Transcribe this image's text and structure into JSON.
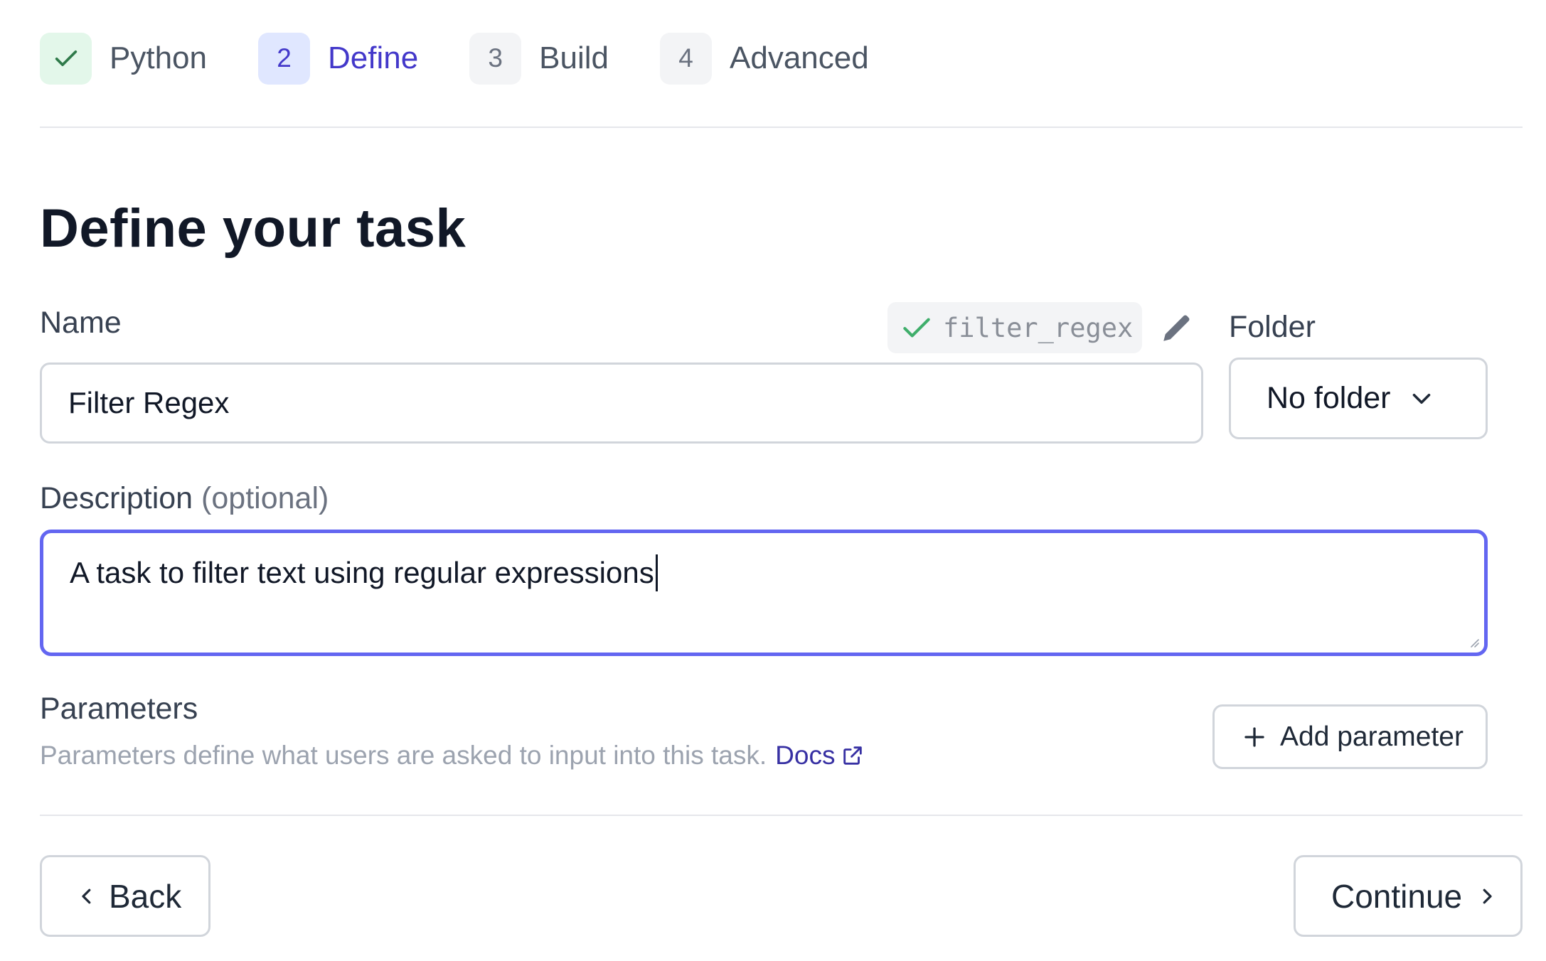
{
  "stepper": {
    "steps": [
      {
        "number": "",
        "label": "Python",
        "state": "done",
        "icon": "check-icon"
      },
      {
        "number": "2",
        "label": "Define",
        "state": "active"
      },
      {
        "number": "3",
        "label": "Build",
        "state": "pending"
      },
      {
        "number": "4",
        "label": "Advanced",
        "state": "pending"
      }
    ]
  },
  "page": {
    "title": "Define your task"
  },
  "name_field": {
    "label": "Name",
    "value": "Filter Regex",
    "slug": "filter_regex",
    "slug_status_icon": "check-icon",
    "edit_icon": "pencil-icon"
  },
  "folder_field": {
    "label": "Folder",
    "selected": "No folder",
    "icon": "chevron-down-icon"
  },
  "description_field": {
    "label": "Description",
    "optional_label": "(optional)",
    "value": "A task to filter text using regular expressions"
  },
  "parameters": {
    "title": "Parameters",
    "help_text": "Parameters define what users are asked to input into this task.",
    "docs_label": "Docs",
    "docs_icon": "external-link-icon",
    "add_button_label": "Add parameter",
    "add_icon": "plus-icon"
  },
  "footer": {
    "back_label": "Back",
    "continue_label": "Continue"
  },
  "colors": {
    "accent": "#4338ca",
    "focus_border": "#6366f1",
    "success": "#3fae6b",
    "border": "#d1d5db",
    "muted_text": "#9ca3af"
  }
}
